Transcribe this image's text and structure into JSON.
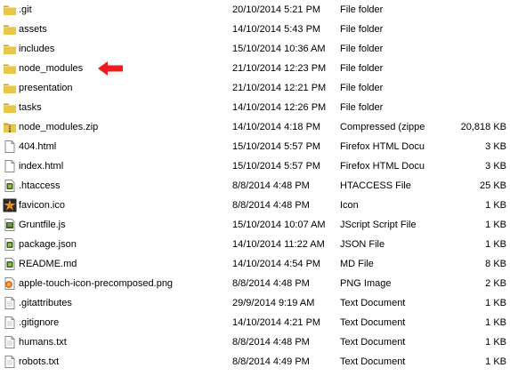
{
  "colors": {
    "folder": "#e8c64a",
    "folder_dark": "#c9a12a",
    "arrow": "#ee1c1c"
  },
  "files": [
    {
      "name": ".git",
      "date": "20/10/2014 5:21 PM",
      "type": "File folder",
      "size": "",
      "icon": "folder-icon"
    },
    {
      "name": "assets",
      "date": "14/10/2014 5:43 PM",
      "type": "File folder",
      "size": "",
      "icon": "folder-icon"
    },
    {
      "name": "includes",
      "date": "15/10/2014 10:36 AM",
      "type": "File folder",
      "size": "",
      "icon": "folder-icon"
    },
    {
      "name": "node_modules",
      "date": "21/10/2014 12:23 PM",
      "type": "File folder",
      "size": "",
      "icon": "folder-icon"
    },
    {
      "name": "presentation",
      "date": "21/10/2014 12:21 PM",
      "type": "File folder",
      "size": "",
      "icon": "folder-icon"
    },
    {
      "name": "tasks",
      "date": "14/10/2014 12:26 PM",
      "type": "File folder",
      "size": "",
      "icon": "folder-icon"
    },
    {
      "name": "node_modules.zip",
      "date": "14/10/2014 4:18 PM",
      "type": "Compressed (zippe...",
      "size": "20,818 KB",
      "icon": "zip-icon"
    },
    {
      "name": "404.html",
      "date": "15/10/2014 5:57 PM",
      "type": "Firefox HTML Docu...",
      "size": "3 KB",
      "icon": "document-icon"
    },
    {
      "name": "index.html",
      "date": "15/10/2014 5:57 PM",
      "type": "Firefox HTML Docu...",
      "size": "3 KB",
      "icon": "document-icon"
    },
    {
      "name": ".htaccess",
      "date": "8/8/2014 4:48 PM",
      "type": "HTACCESS File",
      "size": "25 KB",
      "icon": "editor-file-icon"
    },
    {
      "name": "favicon.ico",
      "date": "8/8/2014 4:48 PM",
      "type": "Icon",
      "size": "1 KB",
      "icon": "favicon-icon"
    },
    {
      "name": "Gruntfile.js",
      "date": "15/10/2014 10:07 AM",
      "type": "JScript Script File",
      "size": "1 KB",
      "icon": "script-file-icon"
    },
    {
      "name": "package.json",
      "date": "14/10/2014 11:22 AM",
      "type": "JSON File",
      "size": "1 KB",
      "icon": "editor-file-icon"
    },
    {
      "name": "README.md",
      "date": "14/10/2014 4:54 PM",
      "type": "MD File",
      "size": "8 KB",
      "icon": "editor-file-icon"
    },
    {
      "name": "apple-touch-icon-precomposed.png",
      "date": "8/8/2014 4:48 PM",
      "type": "PNG Image",
      "size": "2 KB",
      "icon": "image-file-icon"
    },
    {
      "name": ".gitattributes",
      "date": "29/9/2014 9:19 AM",
      "type": "Text Document",
      "size": "1 KB",
      "icon": "text-file-icon"
    },
    {
      "name": ".gitignore",
      "date": "14/10/2014 4:21 PM",
      "type": "Text Document",
      "size": "1 KB",
      "icon": "text-file-icon"
    },
    {
      "name": "humans.txt",
      "date": "8/8/2014 4:48 PM",
      "type": "Text Document",
      "size": "1 KB",
      "icon": "text-file-icon"
    },
    {
      "name": "robots.txt",
      "date": "8/8/2014 4:49 PM",
      "type": "Text Document",
      "size": "1 KB",
      "icon": "text-file-icon"
    }
  ],
  "annotation": {
    "icon": "red-arrow-icon",
    "points_to": "node_modules"
  }
}
